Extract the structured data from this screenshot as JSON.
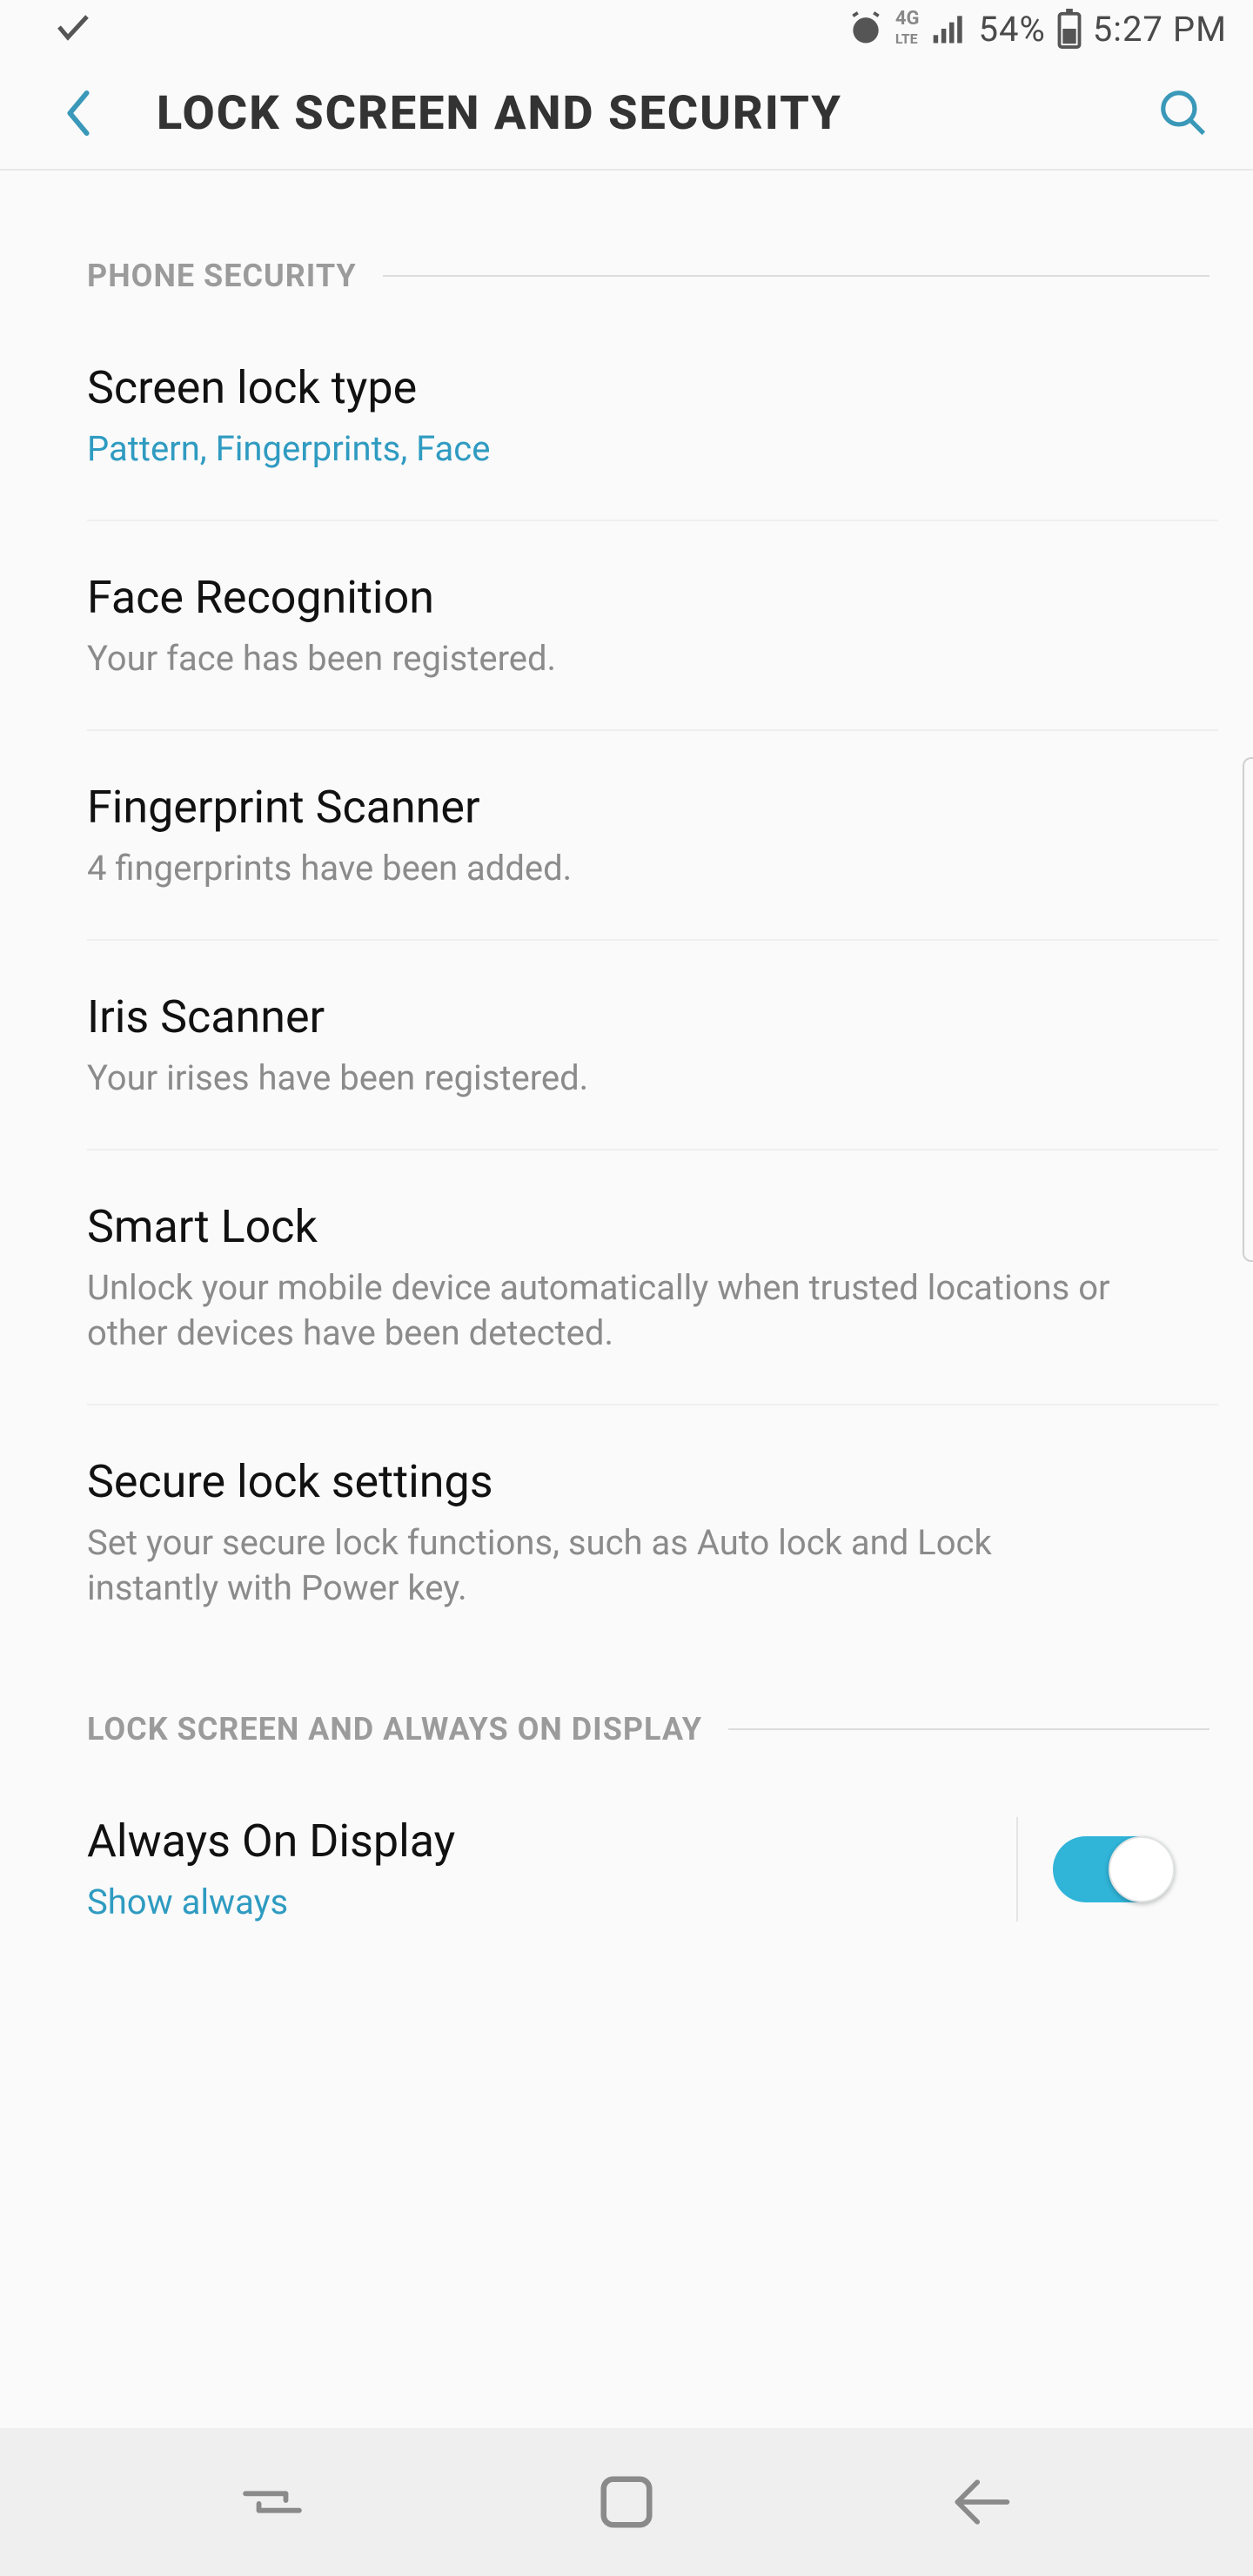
{
  "status": {
    "battery_text": "54%",
    "time": "5:27 PM"
  },
  "header": {
    "title": "LOCK SCREEN AND SECURITY"
  },
  "sections": [
    {
      "label": "PHONE SECURITY",
      "items": [
        {
          "title": "Screen lock type",
          "sub": "Pattern, Fingerprints, Face",
          "accent": true
        },
        {
          "title": "Face Recognition",
          "sub": "Your face has been registered."
        },
        {
          "title": "Fingerprint Scanner",
          "sub": "4 fingerprints have been added."
        },
        {
          "title": "Iris Scanner",
          "sub": "Your irises have been registered."
        },
        {
          "title": "Smart Lock",
          "sub": "Unlock your mobile device automatically when trusted locations or other devices have been detected."
        },
        {
          "title": "Secure lock settings",
          "sub": "Set your secure lock functions, such as Auto lock and Lock instantly with Power key."
        }
      ]
    },
    {
      "label": "LOCK SCREEN AND ALWAYS ON DISPLAY",
      "items": [
        {
          "title": "Always On Display",
          "sub": "Show always",
          "accent": true,
          "toggle": true,
          "toggle_on": true
        }
      ]
    }
  ]
}
